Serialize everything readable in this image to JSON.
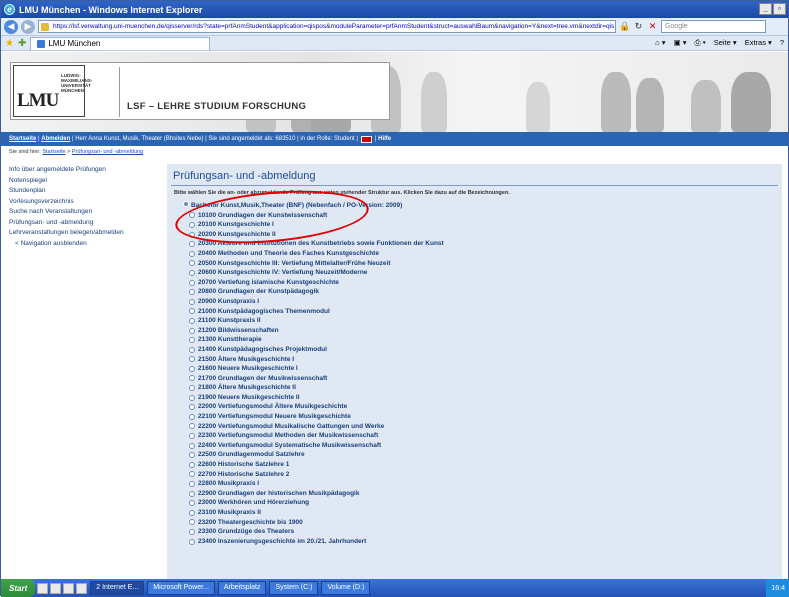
{
  "window": {
    "title": "LMU München - Windows Internet Explorer",
    "url": "https://lsf.verwaltung.uni-muenchen.de/qisserver/rds?state=prfAnmStudent&application=qispos&moduleParameter=prfAnmStudent&struct=auswahlBaum&navigation=Y&next=tree.vm&nextdir=qis",
    "search_placeholder": "Google",
    "tab_title": "LMU München",
    "cmd_page": "Seite",
    "cmd_extras": "Extras"
  },
  "banner": {
    "logo": "LMU",
    "logo_small": "LUDWIG-\nMAXIMILIANS-\nUNIVERSITÄT\nMÜNCHEN",
    "title": "LSF – LEHRE STUDIUM FORSCHUNG"
  },
  "bluebar": {
    "start": "Startseite",
    "logout": "Abmelden",
    "info": "Herr Anna Kunst, Musik, Theater (Bhsites Nebe)  |  Sie sind angemeldet als:  683510  |  in der Rolle: Student  |",
    "help": "Hilfe"
  },
  "breadcrumb": {
    "prefix": "Sie sind hier:",
    "home": "Startseite",
    "current": "Prüfungsan- und -abmeldung"
  },
  "sidebar": {
    "items": [
      "Info über angemeldete Prüfungen",
      "Notenspiegel",
      "Stundenplan",
      "Vorlesungsverzeichnis",
      "Suche nach Veranstaltungen",
      "Prüfungsan- und -abmeldung",
      "Lehrveranstaltungen belegen/abmelden",
      "< Navigation ausblenden"
    ]
  },
  "main": {
    "heading": "Prüfungsan- und -abmeldung",
    "hint": "Bitte wählen Sie die an- oder abzumeldende Prüfung aus unten stehender Struktur aus. Klicken Sie dazu auf die Bezeichnungen.",
    "root": "Bachelor Kunst,Musik,Theater (BNF) (Nebenfach / PO-Version: 2009)",
    "items": [
      "10100 Grundlagen der Kunstwissenschaft",
      "20100 Kunstgeschichte I",
      "20200 Kunstgeschichte II",
      "20300 Akteure und Institutionen des Kunstbetriebs sowie Funktionen der Kunst",
      "20400 Methoden und Theorie des Faches Kunstgeschichte",
      "20500 Kunstgeschichte III: Vertiefung Mittelalter/Frühe Neuzeit",
      "20600 Kunstgeschichte IV: Vertiefung Neuzeit/Moderne",
      "20700 Vertiefung islamische Kunstgeschichte",
      "20800 Grundlagen der Kunstpädagogik",
      "20900 Kunstpraxis I",
      "21000 Kunstpädagogisches Themenmodul",
      "21100 Kunstpraxis II",
      "21200 Bildwissenschaften",
      "21300 Kunsttherapie",
      "21400 Kunstpädagogisches Projektmodul",
      "21500 Ältere Musikgeschichte I",
      "21600 Neuere Musikgeschichte I",
      "21700 Grundlagen der Musikwissenschaft",
      "21800 Ältere Musikgeschichte II",
      "21900 Neuere Musikgeschichte II",
      "22000 Vertiefungsmodul Ältere Musikgeschichte",
      "22100 Vertiefungsmodul Neuere Musikgeschichte",
      "22200 Vertiefungsmodul Musikalische Gattungen und Werke",
      "22300 Vertiefungsmodul Methoden der Musikwissenschaft",
      "22400 Vertiefungsmodul Systematische Musikwissenschaft",
      "22500 Grundlagenmodul Satzlehre",
      "22600 Historische Satzlehre 1",
      "22700 Historische Satzlehre 2",
      "22800 Musikpraxis I",
      "22900 Grundlagen der historischen Musikpädagogik",
      "23000 Werkhören und Hörerziehung",
      "23100 Musikpraxis II",
      "23200 Theatergeschichte bis 1900",
      "23300 Grundzüge des Theaters",
      "23400 Inszenierungsgeschichte im 20./21. Jahrhundert"
    ]
  },
  "taskbar": {
    "start": "Start",
    "tasks": [
      "2 Internet E...",
      "Microsoft Power...",
      "Arbeitsplatz",
      "System (C:)",
      "Volume (D:)"
    ],
    "clock": "16:4"
  }
}
